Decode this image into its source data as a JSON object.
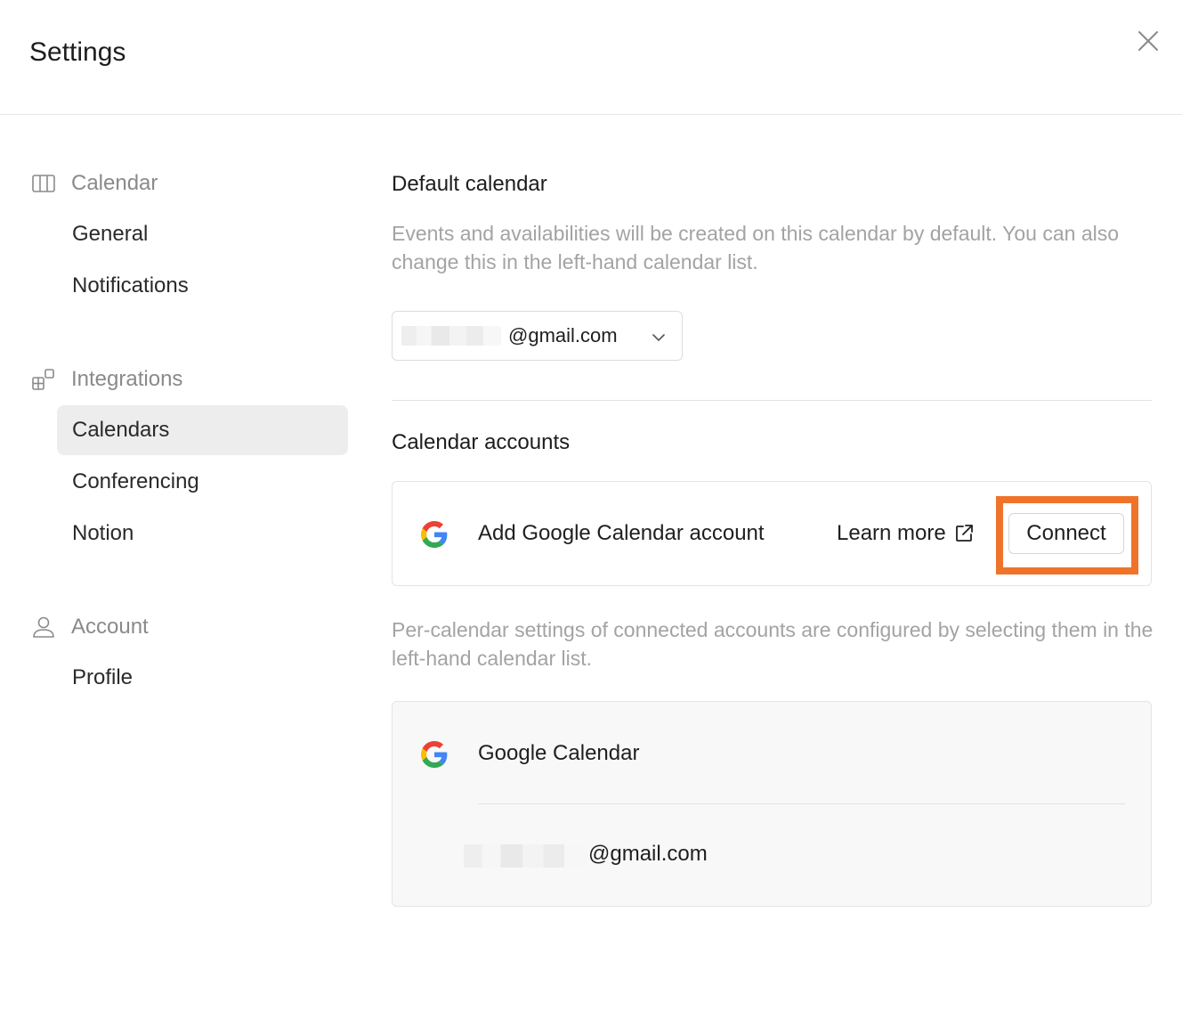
{
  "header": {
    "title": "Settings",
    "close_icon": "close-icon"
  },
  "sidebar": {
    "sections": [
      {
        "label": "Calendar",
        "icon": "calendar-columns-icon"
      },
      {
        "label": "Integrations",
        "icon": "integrations-grid-icon"
      },
      {
        "label": "Account",
        "icon": "person-icon"
      }
    ],
    "items": [
      {
        "label": "General"
      },
      {
        "label": "Notifications"
      },
      {
        "label": "Calendars",
        "active": true
      },
      {
        "label": "Conferencing"
      },
      {
        "label": "Notion"
      },
      {
        "label": "Profile"
      }
    ]
  },
  "main": {
    "default_calendar": {
      "heading": "Default calendar",
      "description": "Events and availabilities will be created on this calendar by default. You can also change this in the left-hand calendar list.",
      "selected_value": "@gmail.com"
    },
    "calendar_accounts": {
      "heading": "Calendar accounts",
      "add_label": "Add Google Calendar account",
      "learn_more": "Learn more",
      "connect_label": "Connect",
      "note": "Per-calendar settings of connected accounts are configured by selecting them in the left-hand calendar list.",
      "provider": "Google Calendar",
      "account_email": "@gmail.com"
    }
  },
  "colors": {
    "highlight": "#f0732a",
    "active_nav_bg": "#ededed",
    "muted_text": "#a3a3a3"
  }
}
